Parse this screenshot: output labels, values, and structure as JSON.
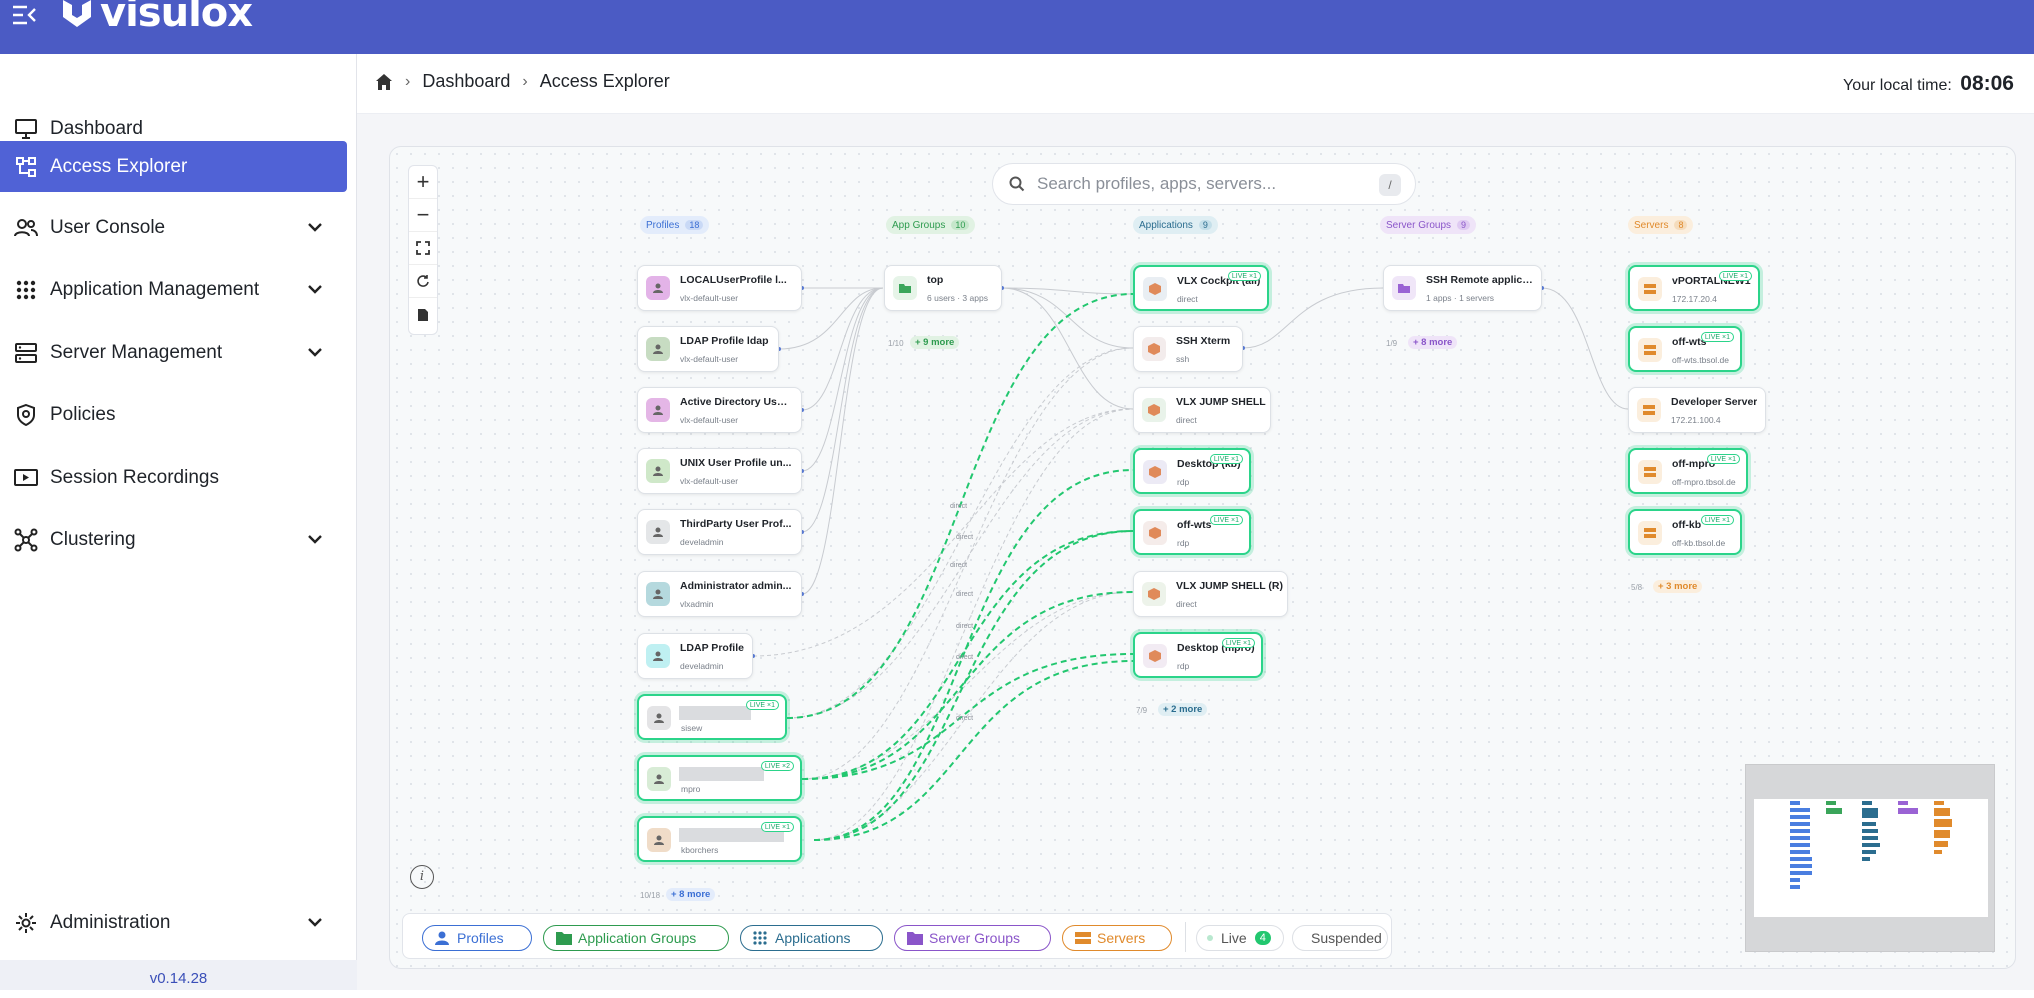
{
  "app": {
    "name": "visulox",
    "version": "v0.14.28"
  },
  "sidebar": {
    "items": [
      {
        "label": "Dashboard",
        "icon": "monitor-icon"
      },
      {
        "label": "Access Explorer",
        "icon": "access-explorer-icon",
        "active": true
      },
      {
        "label": "User Console",
        "icon": "users-icon"
      },
      {
        "label": "Application Management",
        "icon": "grid-icon"
      },
      {
        "label": "Server Management",
        "icon": "server-icon"
      },
      {
        "label": "Policies",
        "icon": "shield-icon"
      },
      {
        "label": "Session Recordings",
        "icon": "video-icon"
      },
      {
        "label": "Clustering",
        "icon": "cluster-icon"
      }
    ],
    "admin": {
      "label": "Administration",
      "icon": "gear-icon"
    }
  },
  "breadcrumb": {
    "home": "home-icon",
    "items": [
      "Dashboard",
      "Access Explorer"
    ]
  },
  "local_time": {
    "label": "Your local time:",
    "value": "08:06"
  },
  "search": {
    "placeholder": "Search profiles, apps, servers...",
    "shortcut": "/"
  },
  "columns": {
    "profiles": {
      "label": "Profiles",
      "count": "18",
      "color": "#3b6fd4"
    },
    "app_groups": {
      "label": "App Groups",
      "count": "10",
      "color": "#2e9b4f"
    },
    "applications": {
      "label": "Applications",
      "count": "9",
      "color": "#2b6d8f"
    },
    "server_groups": {
      "label": "Server Groups",
      "count": "9",
      "color": "#8a55c9"
    },
    "servers": {
      "label": "Servers",
      "count": "8",
      "color": "#e08a2c"
    }
  },
  "profiles": [
    {
      "name": "LOCALUserProfile l...",
      "sub": "vlx-default-user",
      "color": "#e3b3e8"
    },
    {
      "name": "LDAP Profile ldap",
      "sub": "vlx-default-user",
      "color": "#c7dcc2"
    },
    {
      "name": "Active Directory User...",
      "sub": "vlx-default-user",
      "color": "#e4b6e6"
    },
    {
      "name": "UNIX User Profile un...",
      "sub": "vlx-default-user",
      "color": "#cfe8c9"
    },
    {
      "name": "ThirdParty User Prof...",
      "sub": "develadmin",
      "color": "#e4e6e8"
    },
    {
      "name": "Administrator admin...",
      "sub": "vlxadmin",
      "color": "#b5d9de"
    },
    {
      "name": "LDAP Profile",
      "sub": "develadmin",
      "color": "#bff0f2"
    },
    {
      "name": "",
      "sub": "sisew",
      "color": "#e4e4e6",
      "live": "LIVE ×1"
    },
    {
      "name": "",
      "sub": "mpro",
      "color": "#d8ecd6",
      "live": "LIVE ×2"
    },
    {
      "name": "",
      "sub": "kborchers",
      "color": "#f0dcc8",
      "live": "LIVE ×1"
    }
  ],
  "profiles_footer": {
    "count": "10/18",
    "more": "+ 8 more"
  },
  "app_groups": [
    {
      "name": "top",
      "sub": "6 users · 3 apps"
    }
  ],
  "app_groups_footer": {
    "count": "1/10",
    "more": "+ 9 more"
  },
  "applications": [
    {
      "name": "VLX Cockpit (all)",
      "sub": "direct",
      "live": "LIVE ×1"
    },
    {
      "name": "SSH Xterm",
      "sub": "ssh"
    },
    {
      "name": "VLX JUMP SHELL",
      "sub": "direct"
    },
    {
      "name": "Desktop (kb)",
      "sub": "rdp",
      "live": "LIVE ×1"
    },
    {
      "name": "off-wts",
      "sub": "rdp",
      "live": "LIVE ×1"
    },
    {
      "name": "VLX JUMP SHELL (R)",
      "sub": "direct"
    },
    {
      "name": "Desktop (mpro)",
      "sub": "rdp",
      "live": "LIVE ×1"
    }
  ],
  "applications_footer": {
    "count": "7/9",
    "more": "+ 2 more"
  },
  "server_groups": [
    {
      "name": "SSH Remote applica...",
      "sub": "1 apps · 1 servers"
    }
  ],
  "server_groups_footer": {
    "count": "1/9",
    "more": "+ 8 more"
  },
  "servers": [
    {
      "name": "vPORTALNEW1",
      "sub": "172.17.20.4",
      "live": "LIVE ×1"
    },
    {
      "name": "off-wts",
      "sub": "off-wts.tbsol.de",
      "live": "LIVE ×1"
    },
    {
      "name": "Developer Server",
      "sub": "172.21.100.4"
    },
    {
      "name": "off-mpro",
      "sub": "off-mpro.tbsol.de",
      "live": "LIVE ×1"
    },
    {
      "name": "off-kb",
      "sub": "off-kb.tbsol.de",
      "live": "LIVE ×1"
    }
  ],
  "servers_footer": {
    "count": "5/8",
    "more": "+ 3 more"
  },
  "edge_label": "direct",
  "legend": {
    "profiles": "Profiles",
    "app_groups": "Application Groups",
    "applications": "Applications",
    "server_groups": "Server Groups",
    "servers": "Servers",
    "live": "Live",
    "live_count": "4",
    "suspended": "Suspended"
  },
  "colors": {
    "brand": "#4b5bc4",
    "active": "#5062d6",
    "live": "#2bd48a"
  }
}
